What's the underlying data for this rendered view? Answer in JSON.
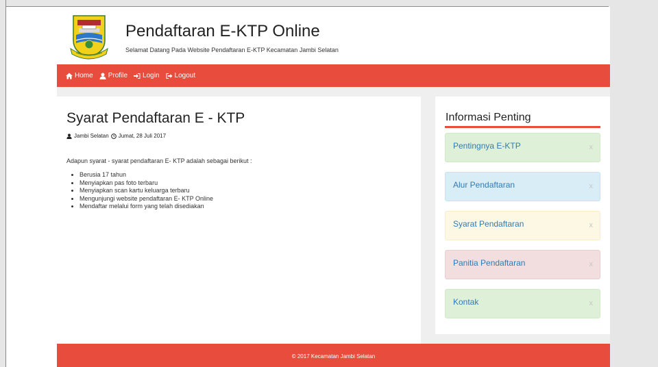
{
  "header": {
    "title": "Pendaftaran E-KTP Online",
    "subtitle": "Selamat Datang Pada Website Pendaftaran E-KTP Kecamatan Jambi Selatan",
    "logo_icon": "jambi-crest-logo"
  },
  "nav": {
    "items": [
      {
        "label": "Home",
        "icon": "home-icon"
      },
      {
        "label": "Profile",
        "icon": "user-icon"
      },
      {
        "label": "Login",
        "icon": "login-icon"
      },
      {
        "label": "Logout",
        "icon": "logout-icon"
      }
    ]
  },
  "article": {
    "title": "Syarat Pendaftaran E - KTP",
    "author": "Jambi Selatan",
    "date": "Jumat, 28 Juli 2017",
    "intro": "Adapun syarat - syarat pendaftaran E- KTP adalah sebagai berikut :",
    "requirements": [
      "Berusia 17 tahun",
      "Menyiapkan pas foto terbaru",
      "Menyiapkan scan kartu keluarga terbaru",
      "Mengunjungi website pendaftaran E- KTP Online",
      "Mendaftar melalui form yang telah disediakan"
    ]
  },
  "sidebar": {
    "title": "Informasi Penting",
    "close_glyph": "x",
    "items": [
      {
        "label": "Pentingnya E-KTP",
        "bg": "#dff0d8",
        "border": "#d0e9c6"
      },
      {
        "label": "Alur Pendaftaran",
        "bg": "#d9edf7",
        "border": "#bce8f1"
      },
      {
        "label": "Syarat Pendaftaran",
        "bg": "#fcf8e3",
        "border": "#faebcc"
      },
      {
        "label": "Panitia Pendaftaran",
        "bg": "#f2dede",
        "border": "#ebccd1"
      },
      {
        "label": "Kontak",
        "bg": "#dff0d8",
        "border": "#d0e9c6"
      }
    ]
  },
  "footer": {
    "text": "© 2017 Kecamatan Jambi Selatan"
  },
  "colors": {
    "accent": "#e84c3d",
    "link": "#2f7ab5"
  }
}
